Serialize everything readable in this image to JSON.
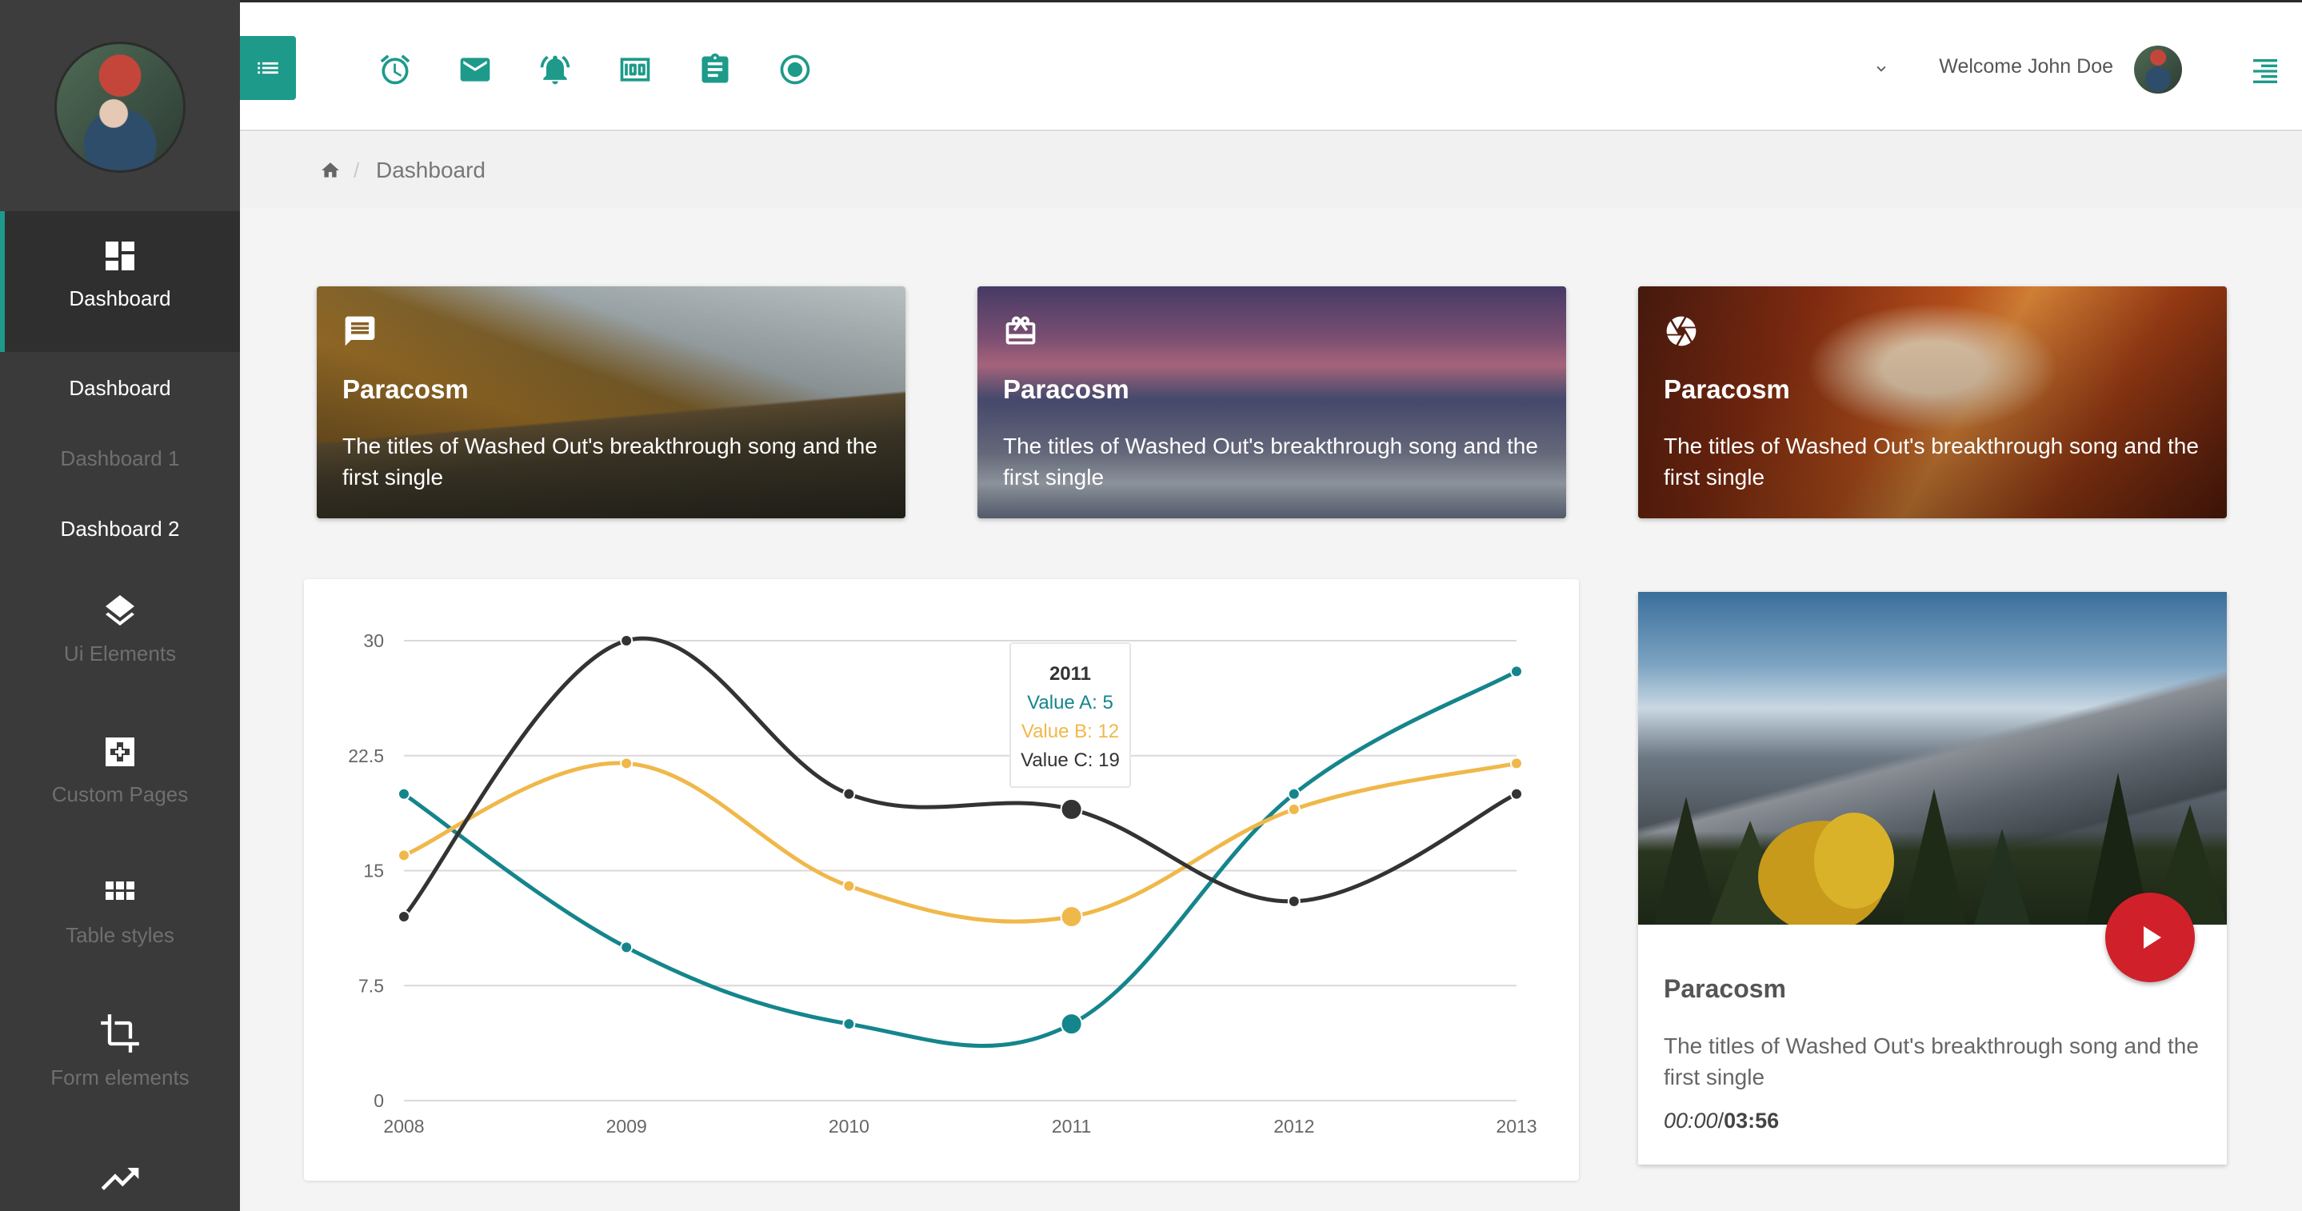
{
  "user": {
    "welcome": "Welcome John Doe"
  },
  "sidebar": {
    "items": [
      {
        "label": "Dashboard",
        "icon": "dashboard-icon"
      },
      {
        "label": "Ui Elements",
        "icon": "layers-icon"
      },
      {
        "label": "Custom Pages",
        "icon": "puzzle-icon"
      },
      {
        "label": "Table styles",
        "icon": "grid-icon"
      },
      {
        "label": "Form elements",
        "icon": "crop-icon"
      },
      {
        "label": "",
        "icon": "trending-up-icon"
      }
    ],
    "subitems": [
      {
        "label": "Dashboard",
        "active": true
      },
      {
        "label": "Dashboard 1",
        "active": false
      },
      {
        "label": "Dashboard 2",
        "active": false
      }
    ]
  },
  "topbar": {
    "icons": [
      "alarm-icon",
      "mail-icon",
      "bell-icon",
      "money-icon",
      "clipboard-icon",
      "record-icon"
    ]
  },
  "breadcrumb": {
    "current": "Dashboard"
  },
  "cards": [
    {
      "title": "Paracosm",
      "text": "The titles of Washed Out's breakthrough song and the first single",
      "icon": "message-icon"
    },
    {
      "title": "Paracosm",
      "text": "The titles of Washed Out's breakthrough song and the first single",
      "icon": "card-giftcard-icon"
    },
    {
      "title": "Paracosm",
      "text": "The titles of Washed Out's breakthrough song and the first single",
      "icon": "camera-shutter-icon"
    }
  ],
  "chart_data": {
    "type": "line",
    "x": [
      "2008",
      "2009",
      "2010",
      "2011",
      "2012",
      "2013"
    ],
    "yticks": [
      "0",
      "7.5",
      "15",
      "22.5",
      "30"
    ],
    "ylim": [
      0,
      30
    ],
    "grid": true,
    "series": [
      {
        "name": "Value A",
        "color": "#15858c",
        "values": [
          20,
          10,
          5,
          5,
          20,
          28
        ]
      },
      {
        "name": "Value B",
        "color": "#f0b84a",
        "values": [
          16,
          22,
          14,
          12,
          19,
          22
        ]
      },
      {
        "name": "Value C",
        "color": "#333333",
        "values": [
          12,
          30,
          20,
          19,
          13,
          20
        ]
      }
    ],
    "tooltip": {
      "title": "2011",
      "lines": [
        "Value A: 5",
        "Value B: 12",
        "Value C: 19"
      ]
    }
  },
  "video": {
    "title": "Paracosm",
    "text": "The titles of Washed Out's breakthrough song and the first single",
    "current": "00:00",
    "separator": "/",
    "total": "03:56"
  }
}
